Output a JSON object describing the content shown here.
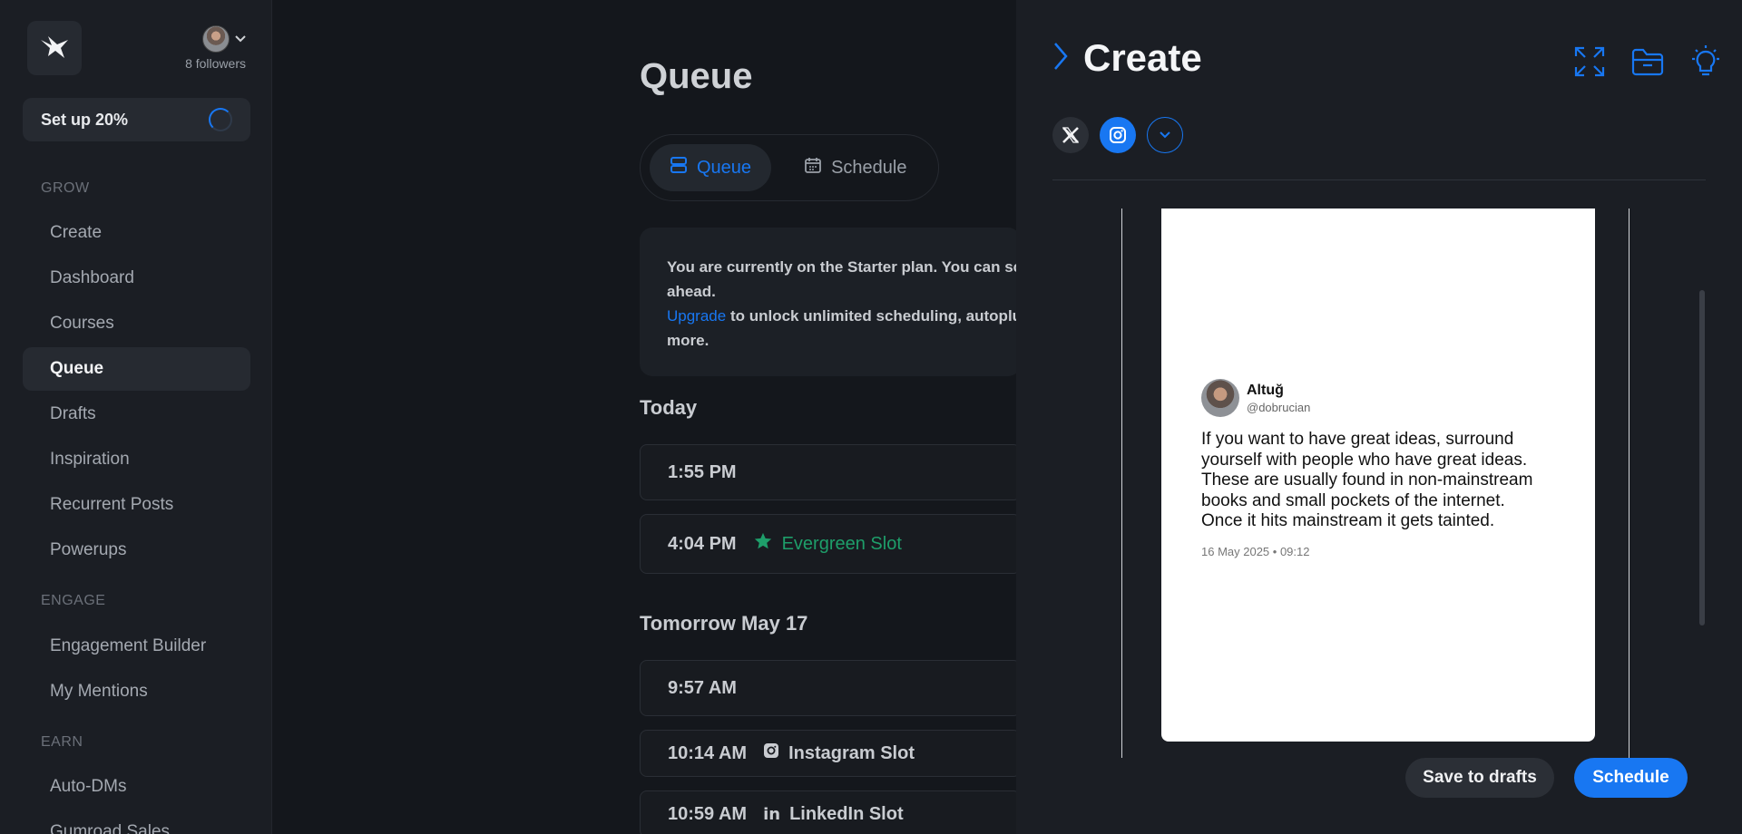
{
  "sidebar": {
    "logo_icon": "bird-logo-icon",
    "followers": "8 followers",
    "setup_label": "Set up 20%",
    "sections": {
      "grow": "GROW",
      "engage": "ENGAGE",
      "earn": "EARN"
    },
    "items": [
      {
        "label": "Create"
      },
      {
        "label": "Dashboard"
      },
      {
        "label": "Courses"
      },
      {
        "label": "Queue",
        "active": true
      },
      {
        "label": "Drafts"
      },
      {
        "label": "Inspiration"
      },
      {
        "label": "Recurrent Posts"
      },
      {
        "label": "Powerups"
      },
      {
        "label": "Engagement Builder"
      },
      {
        "label": "My Mentions"
      },
      {
        "label": "Auto-DMs"
      },
      {
        "label": "Gumroad Sales"
      }
    ]
  },
  "main": {
    "title": "Queue",
    "tabs": [
      {
        "label": "Queue",
        "icon": "queue-icon",
        "active": true
      },
      {
        "label": "Schedule",
        "icon": "calendar-icon"
      }
    ],
    "plan_notice": {
      "line1": "You are currently on the Starter plan. You can sc",
      "line2": "ahead.",
      "link": "Upgrade",
      "line3": " to unlock unlimited scheduling, autoplu",
      "line4": "more."
    },
    "days": [
      {
        "heading": "Today",
        "slots": [
          {
            "time": "1:55 PM"
          },
          {
            "time": "4:04 PM",
            "tag": "Evergreen Slot",
            "icon": "star-icon"
          }
        ]
      },
      {
        "heading": "Tomorrow May 17",
        "slots": [
          {
            "time": "9:57 AM"
          },
          {
            "time": "10:14 AM",
            "tag": "Instagram Slot",
            "icon": "instagram-icon"
          },
          {
            "time": "10:59 AM",
            "tag": "LinkedIn Slot",
            "icon": "linkedin-icon"
          }
        ]
      }
    ]
  },
  "panel": {
    "title": "Create",
    "tools": [
      "expand-icon",
      "folder-icon",
      "lightbulb-icon"
    ],
    "platforms": [
      "x-icon",
      "instagram-icon",
      "chevron-down-icon"
    ],
    "tweet": {
      "name": "Altuğ",
      "handle": "@dobrucian",
      "body": "If you want to have great ideas, surround\nyourself with people who have great ideas.\nThese are usually found in non-mainstream\nbooks and small pockets of the internet.\nOnce it hits mainstream it gets tainted.",
      "date": "16 May 2025 • 09:12"
    },
    "save_label": "Save to drafts",
    "schedule_label": "Schedule"
  },
  "colors": {
    "accent": "#1877f2",
    "evergreen": "#1e9e6a",
    "background": "#14171c",
    "sidebar": "#1b1e24"
  }
}
